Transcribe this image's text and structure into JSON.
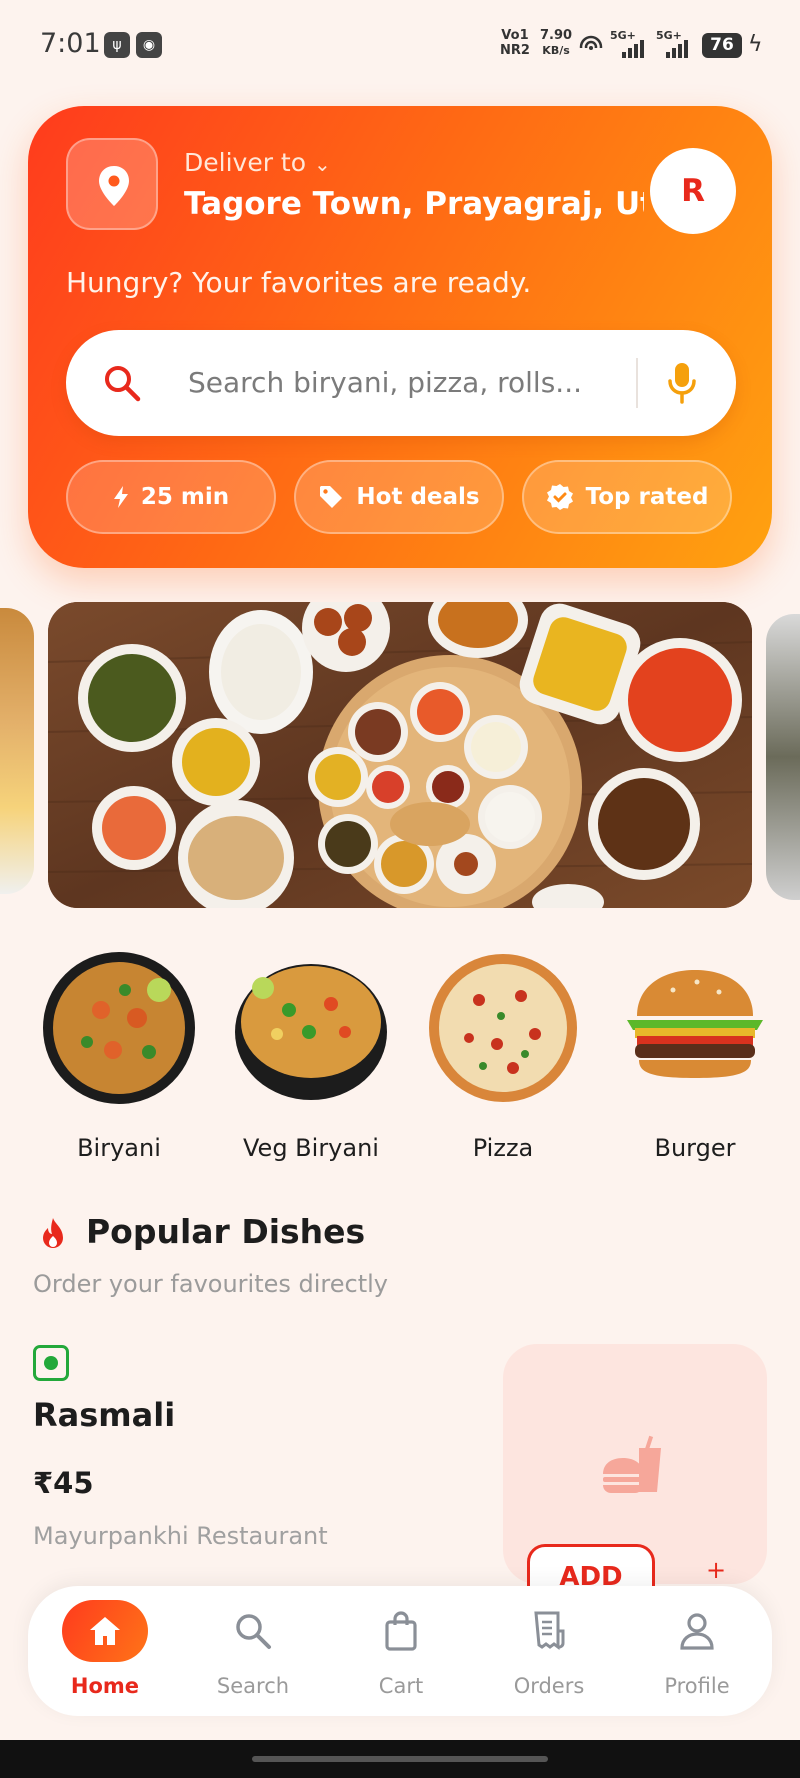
{
  "status": {
    "time": "7:01",
    "net_label_1": "Vo1",
    "net_label_2": "NR2",
    "speed_value": "7.90",
    "speed_unit": "KB/s",
    "sim1": "5G+",
    "sim2": "5G+",
    "battery": "76"
  },
  "header": {
    "deliver_label": "Deliver to",
    "address": "Tagore Town, Prayagraj, Utt...",
    "avatar_initial": "R",
    "tagline": "Hungry? Your favorites are ready."
  },
  "search": {
    "placeholder": "Search biryani, pizza, rolls..."
  },
  "chips": [
    {
      "label": "25 min",
      "icon": "bolt-icon"
    },
    {
      "label": "Hot deals",
      "icon": "tag-icon"
    },
    {
      "label": "Top rated",
      "icon": "verified-badge-icon"
    }
  ],
  "categories": [
    {
      "name": "Biryani"
    },
    {
      "name": "Veg Biryani"
    },
    {
      "name": "Pizza"
    },
    {
      "name": "Burger"
    }
  ],
  "popular": {
    "title": "Popular Dishes",
    "subtitle": "Order your favourites directly",
    "dish": {
      "name": "Rasmali",
      "price": "₹45",
      "restaurant": "Mayurpankhi Restaurant",
      "add_label": "ADD",
      "plus": "+"
    }
  },
  "nav": [
    {
      "label": "Home",
      "icon": "home-icon"
    },
    {
      "label": "Search",
      "icon": "search-icon"
    },
    {
      "label": "Cart",
      "icon": "shopping-bag-icon"
    },
    {
      "label": "Orders",
      "icon": "receipt-icon"
    },
    {
      "label": "Profile",
      "icon": "person-icon"
    }
  ],
  "colors": {
    "brand_red": "#e8291c",
    "brand_orange": "#ff7418",
    "background": "#fdf3ee"
  }
}
